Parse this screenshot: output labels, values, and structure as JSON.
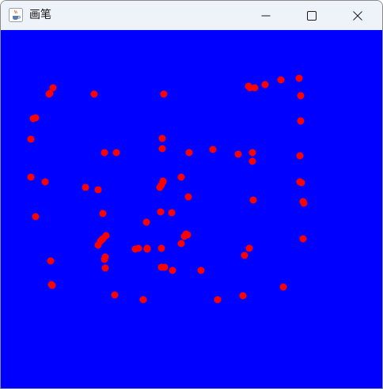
{
  "window": {
    "title": "画笔",
    "canvas_color": "#0000ff",
    "dot_color": "#ff0000"
  },
  "controls": {
    "minimize_icon": "minimize-icon",
    "maximize_icon": "maximize-icon",
    "close_icon": "close-icon",
    "app_icon": "java-coffee-cup-icon"
  },
  "dot_count": 78
}
